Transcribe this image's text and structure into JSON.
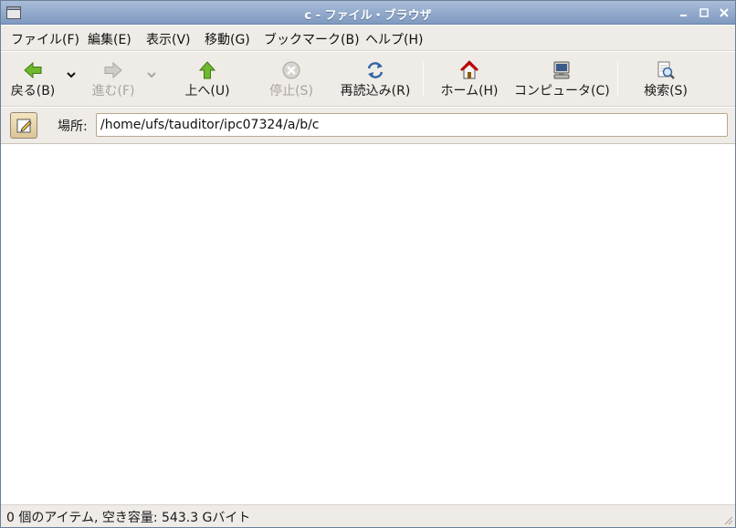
{
  "window": {
    "title": "c - ファイル・ブラウザ"
  },
  "menu": [
    {
      "label": "ファイル(F)"
    },
    {
      "label": "編集(E)"
    },
    {
      "label": "表示(V)"
    },
    {
      "label": "移動(G)"
    },
    {
      "label": "ブックマーク(B)"
    },
    {
      "label": "ヘルプ(H)"
    }
  ],
  "toolbar": {
    "back": {
      "label": "戻る(B)",
      "icon": "back-arrow-icon",
      "enabled": true
    },
    "forward": {
      "label": "進む(F)",
      "icon": "forward-arrow-icon",
      "enabled": false
    },
    "up": {
      "label": "上へ(U)",
      "icon": "up-arrow-icon",
      "enabled": true
    },
    "stop": {
      "label": "停止(S)",
      "icon": "stop-icon",
      "enabled": false
    },
    "reload": {
      "label": "再読込み(R)",
      "icon": "reload-icon",
      "enabled": true
    },
    "home": {
      "label": "ホーム(H)",
      "icon": "home-icon",
      "enabled": true
    },
    "computer": {
      "label": "コンピュータ(C)",
      "icon": "computer-icon",
      "enabled": true
    },
    "search": {
      "label": "検索(S)",
      "icon": "search-icon",
      "enabled": true
    }
  },
  "location": {
    "label": "場所:",
    "value": "/home/ufs/tauditor/ipc07324/a/b/c"
  },
  "status": {
    "text": "0 個のアイテム, 空き容量: 543.3 Gバイト"
  },
  "colors": {
    "titlebar": "#8aa3c8",
    "chrome": "#efebe7",
    "arrow_green": "#4e9a06",
    "home_red": "#cc0000"
  }
}
